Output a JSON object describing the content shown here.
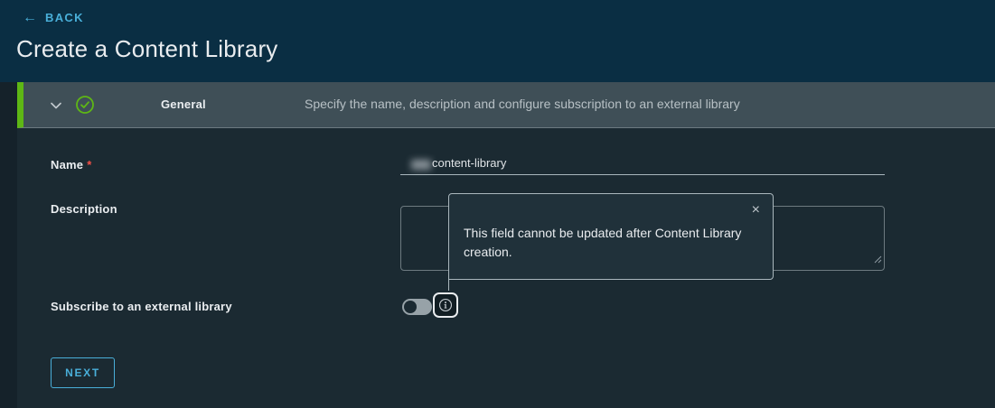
{
  "header": {
    "back_arrow": "←",
    "back_label": "BACK",
    "title": "Create a Content Library"
  },
  "step": {
    "title": "General",
    "description": "Specify the name, description and configure subscription to an external library",
    "status_icon": "check-circle",
    "expand_icon": "chevron-down"
  },
  "form": {
    "name": {
      "label": "Name",
      "required_marker": "*",
      "value": "content-library",
      "redacted_prefix": true
    },
    "description": {
      "label": "Description",
      "value": ""
    },
    "subscribe": {
      "label": "Subscribe to an external library",
      "toggle_state": "off",
      "info_icon": "info-circle"
    },
    "next_label": "NEXT"
  },
  "tooltip": {
    "text": "This field cannot be updated after Content Library creation.",
    "close_icon": "×"
  },
  "colors": {
    "header_bg": "#0a2e43",
    "step_row_bg": "#3f4f57",
    "main_bg": "#1b2a32",
    "accent_blue": "#49afd9",
    "success_green": "#5eb715",
    "required_red": "#f55047"
  }
}
